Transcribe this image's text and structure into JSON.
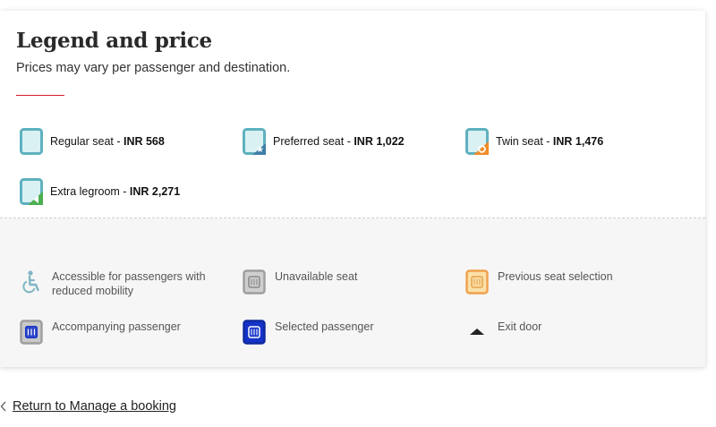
{
  "legend": {
    "title": "Legend and price",
    "subtitle": "Prices may vary per passenger and destination.",
    "seats": [
      {
        "name": "Regular seat",
        "sep": " - ",
        "price": "INR 568",
        "icon": "regular-seat-icon"
      },
      {
        "name": "Preferred seat",
        "sep": " - ",
        "price": "INR 1,022",
        "icon": "preferred-seat-icon"
      },
      {
        "name": "Twin seat",
        "sep": " - ",
        "price": "INR 1,476",
        "icon": "twin-seat-icon"
      },
      {
        "name": "Extra legroom",
        "sep": " - ",
        "price": "INR 2,271",
        "icon": "extra-legroom-seat-icon"
      }
    ],
    "statuses": [
      {
        "label": "Accessible for passengers with reduced mobility",
        "icon": "wheelchair-icon"
      },
      {
        "label": "Unavailable seat",
        "icon": "unavailable-seat-icon"
      },
      {
        "label": "Previous seat selection",
        "icon": "previous-seat-icon"
      },
      {
        "label": "Accompanying passenger",
        "icon": "accompanying-passenger-icon"
      },
      {
        "label": "Selected passenger",
        "icon": "selected-passenger-icon"
      },
      {
        "label": "Exit door",
        "icon": "exit-door-icon"
      }
    ]
  },
  "navigation": {
    "back_link": "Return to Manage a booking"
  },
  "colors": {
    "accent_red": "#d7192d",
    "seat_teal": "#5eb1bf",
    "seat_fill": "#d9f1f3",
    "preferred_blue": "#3f7ea6",
    "twin_orange": "#f28c28",
    "legroom_green": "#4caf50",
    "selected_blue": "#1533c9",
    "previous_orange": "#f0a04b"
  }
}
